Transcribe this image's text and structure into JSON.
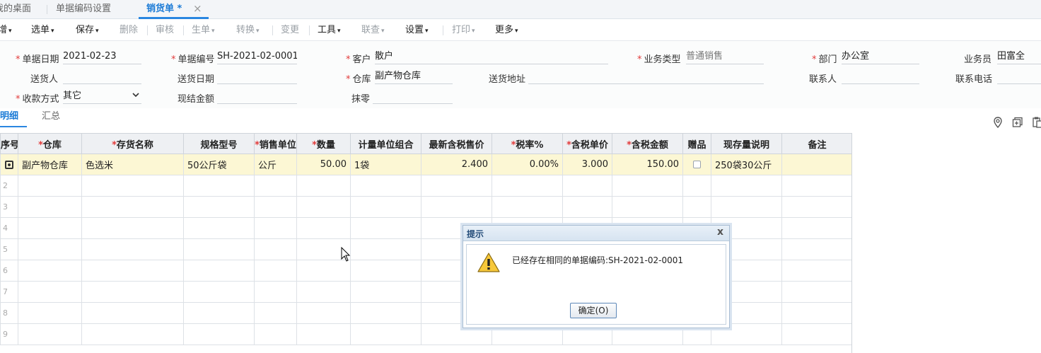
{
  "tabs": {
    "desktop": "我的桌面",
    "coding": "单据编码设置",
    "sales": "销货单 *",
    "close": "×"
  },
  "toolbar": {
    "add": "增",
    "select": "选单",
    "save": "保存",
    "delete": "删除",
    "audit": "审核",
    "generate": "生单",
    "convert": "转换",
    "change": "变更",
    "tools": "工具",
    "linkquery": "联查",
    "settings": "设置",
    "print": "打印",
    "more": "更多",
    "caret": "▾"
  },
  "form": {
    "doc_date_label": "单据日期",
    "doc_date": "2021-02-23",
    "doc_no_label": "单据编号",
    "doc_no": "SH-2021-02-0001",
    "customer_label": "客户",
    "customer": "散户",
    "biz_type_label": "业务类型",
    "biz_type": "普通销售",
    "dept_label": "部门",
    "dept": "办公室",
    "salesman_label": "业务员",
    "salesman": "田富全",
    "deliverer_label": "送货人",
    "delivery_date_label": "送货日期",
    "warehouse_label": "仓库",
    "warehouse": "副产物仓库",
    "delivery_addr_label": "送货地址",
    "contact_label": "联系人",
    "phone_label": "联系电话",
    "pay_method_label": "收款方式",
    "pay_method": "其它",
    "cash_amount_label": "现结金额",
    "rounding_label": "抹零",
    "req": "*"
  },
  "subtabs": {
    "detail": "明细",
    "summary": "汇总"
  },
  "grid": {
    "headers": [
      "序号",
      "仓库",
      "存货名称",
      "规格型号",
      "销售单位",
      "数量",
      "计量单位组合",
      "最新含税售价",
      "税率%",
      "含税单价",
      "含税金额",
      "赠品",
      "现存量说明",
      "备注"
    ],
    "required": [
      "",
      "*",
      "*",
      "",
      "*",
      "*",
      "",
      "",
      "*",
      "*",
      "*",
      "",
      "",
      ""
    ],
    "row": {
      "warehouse": "副产物仓库",
      "item": "色选米",
      "spec": "50公斤袋",
      "unit": "公斤",
      "qty": "50.00",
      "unit_combo": "1袋",
      "latest_price": "2.400",
      "tax_rate": "0.00%",
      "unit_price": "3.000",
      "amount": "150.00",
      "stock_desc": "250袋30公斤"
    },
    "row_numbers": [
      "2",
      "3",
      "4",
      "5",
      "6",
      "7",
      "8",
      "9"
    ]
  },
  "dialog": {
    "title": "提示",
    "close": "x",
    "message": "已经存在相同的单据编码:SH-2021-02-0001",
    "ok": "确定(O)"
  }
}
